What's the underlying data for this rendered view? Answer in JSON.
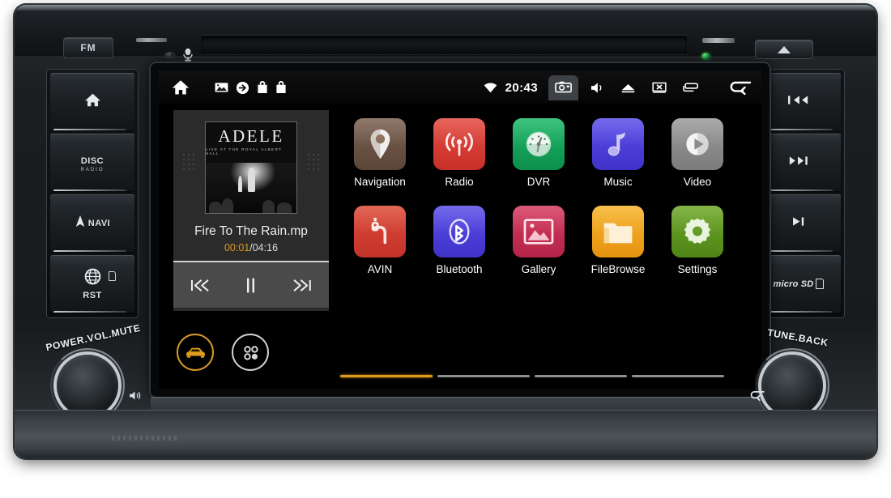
{
  "device": {
    "top_bar": {
      "fm_button": "FM",
      "mic_icon": "microphone-icon",
      "reset_hole": "reset-pinhole",
      "eject_icon": "eject-icon",
      "led": "power-led"
    },
    "left_buttons": [
      {
        "name": "home",
        "label": "",
        "icon": "home-icon"
      },
      {
        "name": "disc-radio",
        "label": "DISC",
        "sub": "RADIO",
        "icon": "disc-radio-icon"
      },
      {
        "name": "navi",
        "label": "NAVI",
        "icon": "navi-icon"
      },
      {
        "name": "reset",
        "label": "RST",
        "icon": "globe-icon"
      }
    ],
    "right_buttons": [
      {
        "name": "previous-track",
        "label": "",
        "icon": "previous-track-icon"
      },
      {
        "name": "next-track",
        "label": "",
        "icon": "next-track-icon"
      },
      {
        "name": "play-pause",
        "label": "",
        "icon": "play-pause-icon"
      },
      {
        "name": "micro-sd-slot",
        "label": "micro SD",
        "icon": "sd-card-icon"
      }
    ],
    "left_knob": {
      "label": "POWER.VOL.MUTE",
      "icon": "speaker-mute-icon"
    },
    "right_knob": {
      "label": "TUNE.BACK",
      "icon": "back-arrow-icon"
    }
  },
  "screen": {
    "status_bar": {
      "home_icon": "home-icon",
      "notifications": [
        "image-icon",
        "download-arrow-icon",
        "shopping-bag-icon",
        "shopping-bag-icon"
      ],
      "wifi_icon": "wifi-icon",
      "clock": "20:43",
      "buttons": [
        "screenshot-icon",
        "volume-icon",
        "eject-icon",
        "screen-off-icon",
        "recents-icon",
        "back-icon"
      ]
    },
    "music_widget": {
      "album_title": "ADELE",
      "album_subtitle": "LIVE AT THE ROYAL ALBERT HALL",
      "track_title": "Fire To The Rain.mp",
      "elapsed": "00:01",
      "separator": "/",
      "duration": "04:16",
      "controls": [
        "previous-icon",
        "pause-icon",
        "next-icon"
      ]
    },
    "dock": [
      {
        "name": "car-mode",
        "icon": "car-icon",
        "active": true
      },
      {
        "name": "app-drawer",
        "icon": "app-drawer-icon",
        "active": false
      }
    ],
    "apps": [
      {
        "label": "Navigation",
        "icon": "map-pin-icon",
        "color": "#6b5344"
      },
      {
        "label": "Radio",
        "icon": "broadcast-icon",
        "color": "#d93a33"
      },
      {
        "label": "DVR",
        "icon": "gauge-icon",
        "color": "#14a05a"
      },
      {
        "label": "Music",
        "icon": "music-note-icon",
        "color": "#4a3fdb"
      },
      {
        "label": "Video",
        "icon": "play-circle-icon",
        "color": "#8b8b8b"
      },
      {
        "label": "AVIN",
        "icon": "av-input-icon",
        "color": "#cf3a2c"
      },
      {
        "label": "Bluetooth",
        "icon": "bluetooth-icon",
        "color": "#4a3fdb"
      },
      {
        "label": "Gallery",
        "icon": "photo-icon",
        "color": "#c62a52"
      },
      {
        "label": "FileBrowse",
        "icon": "folder-icon",
        "color": "#f0a41c"
      },
      {
        "label": "Settings",
        "icon": "gear-icon",
        "color": "#5e9420"
      }
    ],
    "page_indicator": {
      "total": 4,
      "active_index": 0
    },
    "colors": {
      "accent": "#e09a1e",
      "screen_bg": "#000000",
      "widget_bg": "#2b2b2b",
      "transport_bg": "#4a4a4a"
    }
  }
}
